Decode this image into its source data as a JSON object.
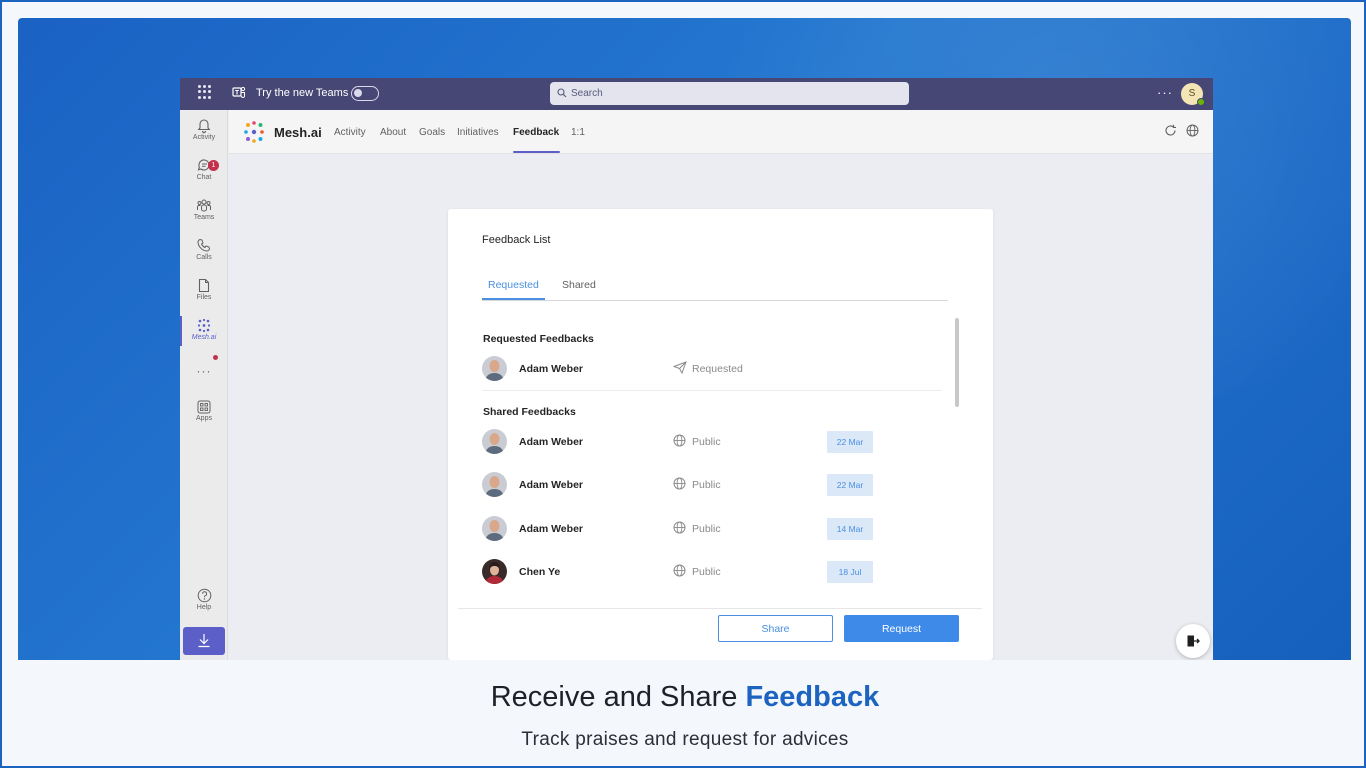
{
  "topbar": {
    "try_label": "Try the new Teams",
    "search_placeholder": "Search",
    "more": "···",
    "avatar_initial": "S"
  },
  "rail": {
    "items": [
      {
        "label": "Activity",
        "icon": "bell-icon"
      },
      {
        "label": "Chat",
        "icon": "chat-icon",
        "badge": "1"
      },
      {
        "label": "Teams",
        "icon": "teams-icon"
      },
      {
        "label": "Calls",
        "icon": "phone-icon"
      },
      {
        "label": "Files",
        "icon": "file-icon"
      },
      {
        "label": "Mesh.ai",
        "icon": "mesh-icon",
        "active": true
      },
      {
        "label": "",
        "icon": "more-icon"
      },
      {
        "label": "Apps",
        "icon": "apps-icon"
      },
      {
        "label": "Help",
        "icon": "help-icon"
      }
    ],
    "more_dots": "···"
  },
  "app": {
    "name": "Mesh.ai",
    "tabs": [
      "Activity",
      "About",
      "Goals",
      "Initiatives",
      "Feedback",
      "1:1"
    ],
    "active_tab": "Feedback"
  },
  "card": {
    "title": "Feedback List",
    "tabs": {
      "requested": "Requested",
      "shared": "Shared"
    },
    "requested_heading": "Requested Feedbacks",
    "shared_heading": "Shared Feedbacks",
    "requested": [
      {
        "name": "Adam Weber",
        "status": "Requested"
      }
    ],
    "shared": [
      {
        "name": "Adam Weber",
        "visibility": "Public",
        "date": "22 Mar"
      },
      {
        "name": "Adam Weber",
        "visibility": "Public",
        "date": "22 Mar"
      },
      {
        "name": "Adam Weber",
        "visibility": "Public",
        "date": "14 Mar"
      },
      {
        "name": "Chen Ye",
        "visibility": "Public",
        "date": "18 Jul"
      }
    ],
    "share_button": "Share",
    "request_button": "Request"
  },
  "caption": {
    "main": "Receive and Share ",
    "accent": "Feedback",
    "sub": "Track praises and request for advices"
  },
  "colors": {
    "teams_bar": "#464775",
    "accent_blue": "#1c64c0",
    "primary_button": "#3d8ae8",
    "teams_purple": "#5b5fc7"
  }
}
